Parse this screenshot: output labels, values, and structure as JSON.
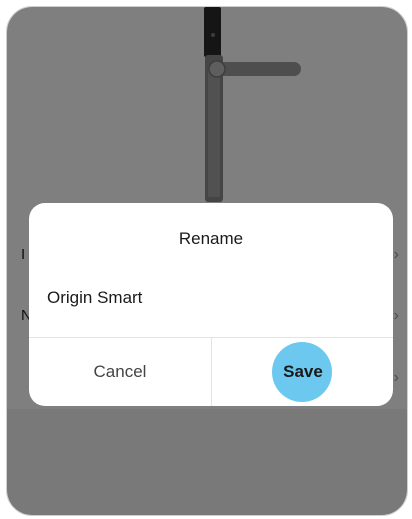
{
  "background": {
    "rows": [
      {
        "letter": "I"
      },
      {
        "letter": "N"
      },
      {
        "letter": ""
      }
    ]
  },
  "dialog": {
    "title": "Rename",
    "name_value": "Origin Smart",
    "cancel_label": "Cancel",
    "save_label": "Save"
  },
  "colors": {
    "tap_highlight": "#6cc8ef",
    "overlay": "rgba(0,0,0,0.5)"
  }
}
